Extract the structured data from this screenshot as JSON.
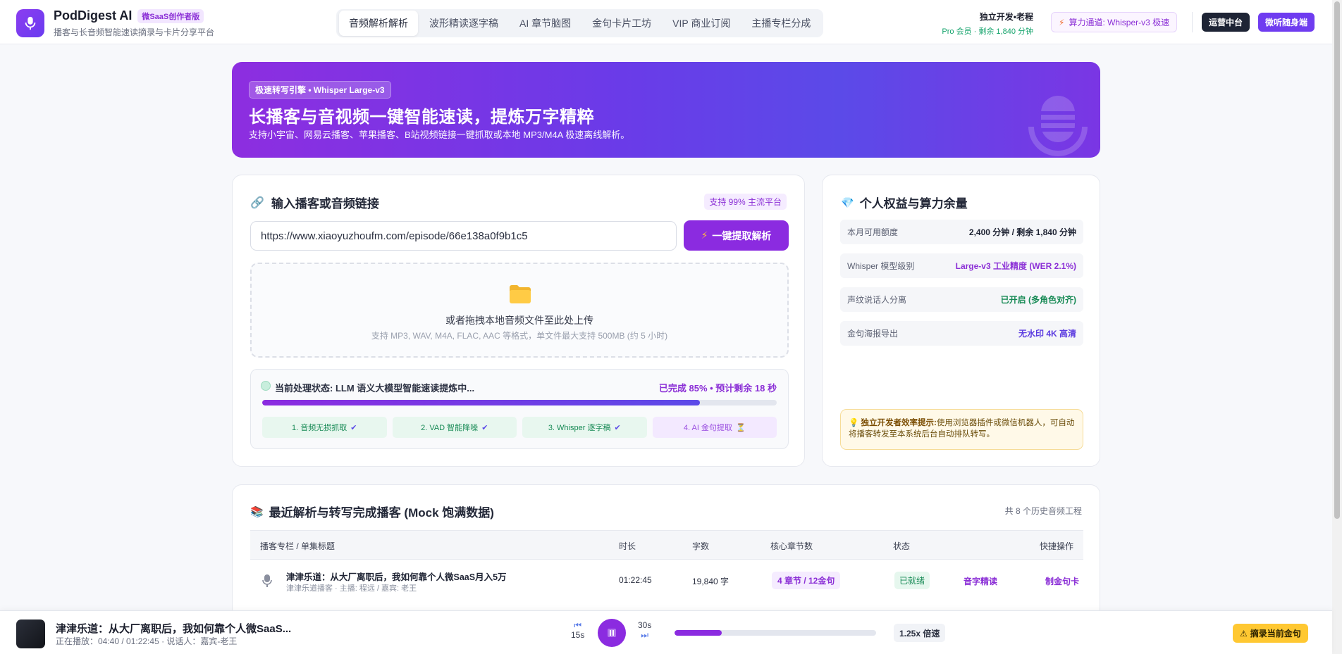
{
  "header": {
    "brand_title": "PodDigest AI",
    "brand_badge": "微SaaS创作者版",
    "brand_sub": "播客与长音频智能速读摘录与卡片分享平台",
    "nav": [
      {
        "label": "音频解析解析",
        "active": true
      },
      {
        "label": "波形精读逐字稿",
        "active": false
      },
      {
        "label": "AI 章节脑图",
        "active": false
      },
      {
        "label": "金句卡片工坊",
        "active": false
      },
      {
        "label": "VIP 商业订阅",
        "active": false
      },
      {
        "label": "主播专栏分成",
        "active": false
      }
    ],
    "user_name": "独立开发•老程",
    "user_quota": "Pro 会员 · 剩余 1,840 分钟",
    "engine_chip": "算力通道: Whisper-v3 极速",
    "ops_button": "运营中台",
    "mini_button": "微听随身端"
  },
  "hero": {
    "badge": "极速转写引擎 • Whisper Large-v3",
    "title": "长播客与音视频一键智能速读，提炼万字精粹",
    "subtitle": "支持小宇宙、网易云播客、苹果播客、B站视频链接一键抓取或本地 MP3/M4A 极速离线解析。"
  },
  "input_card": {
    "title": "输入播客或音频链接",
    "support_tag": "支持 99% 主流平台",
    "url_value": "https://www.xiaoyuzhoufm.com/episode/66e138a0f9b1c5",
    "extract_button": "一键提取解析",
    "dropzone_main": "或者拖拽本地音频文件至此处上传",
    "dropzone_sub": "支持 MP3, WAV, M4A, FLAC, AAC 等格式，单文件最大支持 500MB (约 5 小时)",
    "status_text": "当前处理状态: LLM 语义大模型智能速读提炼中...",
    "status_progress": "已完成 85% • 预计剩余 18 秒",
    "progress": 0.85,
    "steps": [
      {
        "label": "1. 音频无损抓取",
        "mark": "✔",
        "done": true
      },
      {
        "label": "2. VAD 智能降噪",
        "mark": "✔",
        "done": true
      },
      {
        "label": "3. Whisper 逐字稿",
        "mark": "✔",
        "done": true
      },
      {
        "label": "4. AI 金句提取",
        "mark": "⏳",
        "done": false
      }
    ]
  },
  "rights_card": {
    "title": "个人权益与算力余量",
    "rows": [
      {
        "label": "本月可用额度",
        "value": "2,400 分钟 / 剩余 1,840 分钟",
        "color": "#1e2333"
      },
      {
        "label": "Whisper 模型级别",
        "value": "Large-v3 工业精度 (WER 2.1%)",
        "color": "#8b2fd6"
      },
      {
        "label": "声纹说话人分离",
        "value": "已开启 (多角色对齐)",
        "color": "#178a55"
      },
      {
        "label": "金句海报导出",
        "value": "无水印 4K 高清",
        "color": "#5b3be0"
      }
    ],
    "tip_bold": "独立开发者效率提示:",
    "tip_text": "使用浏览器插件或微信机器人，可自动将播客转发至本系统后台自动排队转写。"
  },
  "table_card": {
    "title": "最近解析与转写完成播客 (Mock 饱满数据)",
    "count": "共 8 个历史音频工程",
    "columns": [
      "播客专栏 / 单集标题",
      "时长",
      "字数",
      "核心章节数",
      "状态",
      "快捷操作"
    ],
    "rows": [
      {
        "title": "津津乐道：从大厂离职后，我如何靠个人微SaaS月入5万",
        "sub": "津津乐道播客 · 主播: 程远 / 嘉宾: 老王",
        "duration": "01:22:45",
        "words": "19,840 字",
        "chapters": "4 章节 / 12金句",
        "status": "已就绪",
        "action1": "音字精读",
        "action2": "制金句卡"
      }
    ]
  },
  "player": {
    "title": "津津乐道：从大厂离职后，我如何靠个人微SaaS...",
    "sub": "正在播放：04:40 / 01:22:45 · 说话人：嘉宾-老王",
    "back_label": "15s",
    "fwd_label": "30s",
    "progress": 0.236,
    "speed": "1.25x 倍速",
    "clip_button": "摘录当前金句"
  }
}
